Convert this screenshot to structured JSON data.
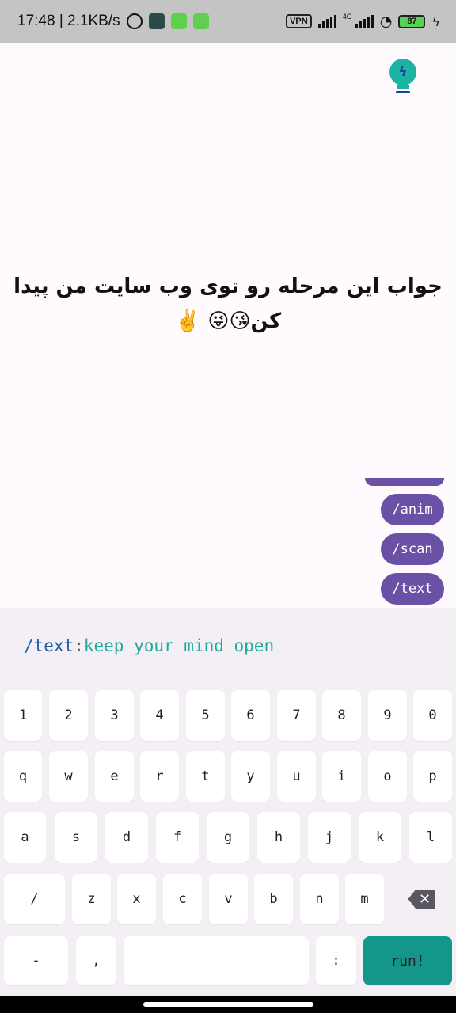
{
  "status_bar": {
    "time_speed": "17:48 | 2.1KB/s",
    "vpn": "VPN",
    "network": "4G",
    "battery": "87"
  },
  "header": {
    "icon": "lightbulb-bolt-icon"
  },
  "message": {
    "text": "جواب این مرحله رو توی وب سایت من پیدا کن😘😜 ✌️"
  },
  "chips": [
    "/anim",
    "/scan",
    "/text"
  ],
  "command_input": {
    "prefix": "/text",
    "separator": ":",
    "value": "keep your mind open"
  },
  "keyboard": {
    "row1": [
      "1",
      "2",
      "3",
      "4",
      "5",
      "6",
      "7",
      "8",
      "9",
      "0"
    ],
    "row2": [
      "q",
      "w",
      "e",
      "r",
      "t",
      "y",
      "u",
      "i",
      "o",
      "p"
    ],
    "row3": [
      "a",
      "s",
      "d",
      "f",
      "g",
      "h",
      "j",
      "k",
      "l"
    ],
    "row4": [
      "/",
      "z",
      "x",
      "c",
      "v",
      "b",
      "n",
      "m"
    ],
    "row5": {
      "dash": "-",
      "comma": ",",
      "colon": ":",
      "run": "run!"
    }
  },
  "colors": {
    "chip": "#6a51a5",
    "run_key": "#14978a",
    "prefix": "#1e5fa8",
    "value": "#1fa99a"
  }
}
